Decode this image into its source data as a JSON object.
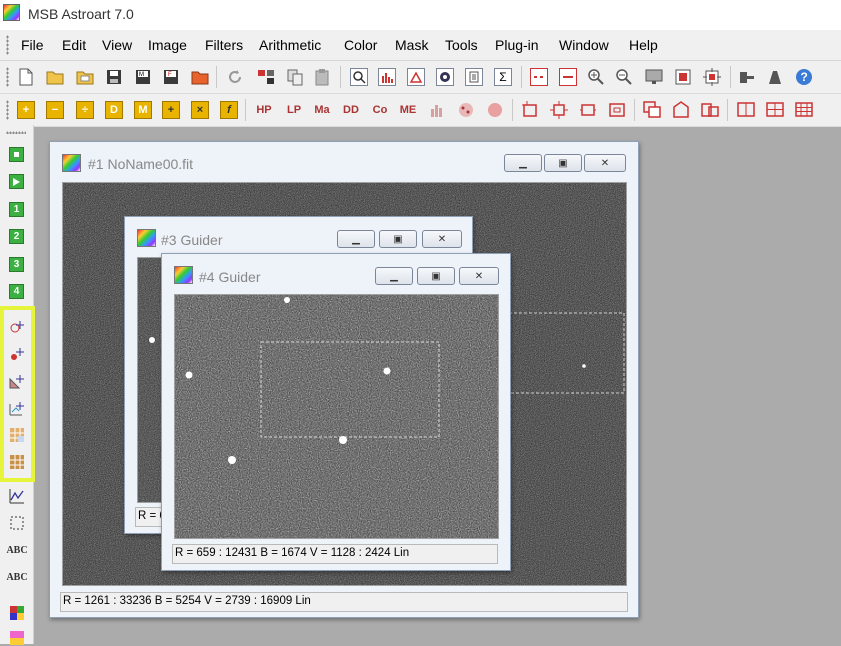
{
  "app": {
    "title": "MSB Astroart 7.0"
  },
  "menu": [
    "File",
    "Edit",
    "View",
    "Image",
    "Filters",
    "Arithmetic",
    "Color",
    "Mask",
    "Tools",
    "Plug-in",
    "Window",
    "Help"
  ],
  "toolbar2": {
    "labels": [
      "HP",
      "LP",
      "Ma",
      "DD",
      "Co",
      "ME"
    ]
  },
  "lefttoolbar": {
    "numbers": [
      "1",
      "2",
      "3",
      "4"
    ],
    "text_tools": [
      "ABC",
      "ABC"
    ]
  },
  "windows": {
    "w1": {
      "title": "#1 NoName00.fit",
      "status": "R = 1261 : 33236    B = 5254    V = 2739 : 16909 Lin"
    },
    "w3": {
      "title": "#3 Guider",
      "status": "R = 6"
    },
    "w4": {
      "title": "#4 Guider",
      "status": "R = 659 : 12431    B = 1674    V = 1128 : 2424 Lin"
    }
  },
  "colors": {
    "highlight": "#e6f43c",
    "button_green": "#3cb043",
    "button_yellow": "#e8b400"
  },
  "icons": [
    "app-icon",
    "new-file-icon",
    "open-icon",
    "open-folder-icon",
    "save-icon",
    "save-as-icon",
    "save-all-icon",
    "folder-icon",
    "refresh-icon",
    "zoom-fit-icon",
    "copy-icon",
    "paste-icon",
    "magnify-icon",
    "histogram-icon",
    "graph-icon",
    "target-icon",
    "document-icon",
    "sum-icon",
    "zoom-in-icon",
    "zoom-out-icon",
    "monitor-icon",
    "help-icon"
  ]
}
